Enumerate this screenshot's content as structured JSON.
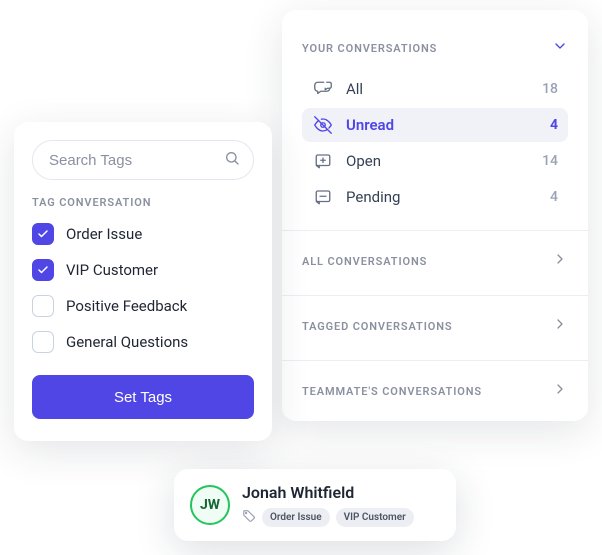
{
  "tagPanel": {
    "searchPlaceholder": "Search Tags",
    "heading": "TAG CONVERSATION",
    "tags": [
      {
        "label": "Order Issue",
        "checked": true
      },
      {
        "label": "VIP Customer",
        "checked": true
      },
      {
        "label": "Positive Feedback",
        "checked": false
      },
      {
        "label": "General Questions",
        "checked": false
      }
    ],
    "button": "Set Tags"
  },
  "conversations": {
    "groups": [
      {
        "title": "YOUR CONVERSATIONS",
        "expanded": true,
        "items": [
          {
            "icon": "chat",
            "label": "All",
            "count": 18,
            "selected": false
          },
          {
            "icon": "eye-off",
            "label": "Unread",
            "count": 4,
            "selected": true
          },
          {
            "icon": "plus-box",
            "label": "Open",
            "count": 14,
            "selected": false
          },
          {
            "icon": "pending",
            "label": "Pending",
            "count": 4,
            "selected": false
          }
        ]
      },
      {
        "title": "ALL CONVERSATIONS",
        "expanded": false
      },
      {
        "title": "TAGGED CONVERSATIONS",
        "expanded": false
      },
      {
        "title": "TEAMMATE'S CONVERSATIONS",
        "expanded": false
      }
    ]
  },
  "contact": {
    "initials": "JW",
    "name": "Jonah Whitfield",
    "tags": [
      "Order Issue",
      "VIP Customer"
    ]
  }
}
